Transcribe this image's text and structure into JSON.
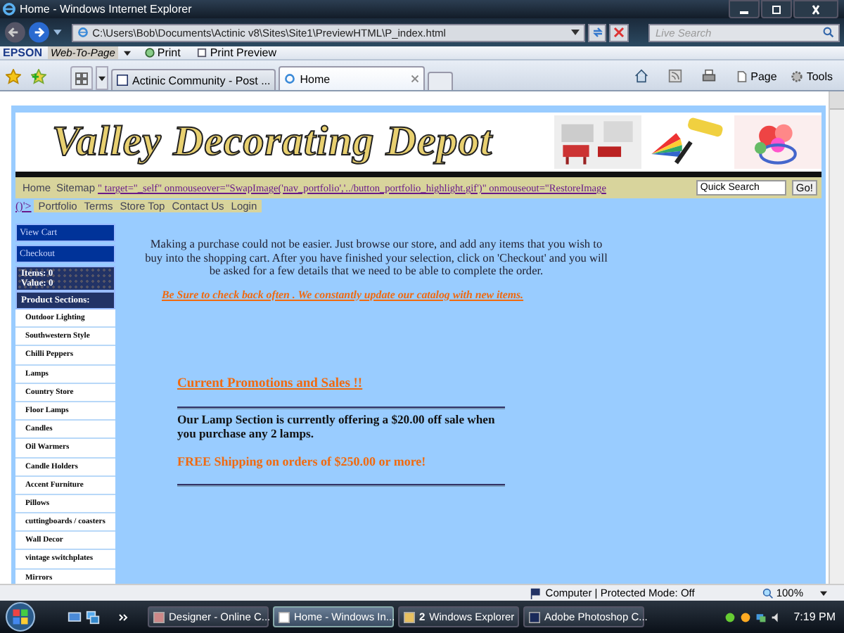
{
  "window": {
    "title": "Home - Windows Internet Explorer"
  },
  "address_bar": {
    "value": "C:\\Users\\Bob\\Documents\\Actinic v8\\Sites\\Site1\\PreviewHTML\\P_index.html",
    "search_placeholder": "Live Search"
  },
  "epson_toolbar": {
    "brand": "EPSON",
    "web_to_page": "Web-To-Page",
    "print": "Print",
    "print_preview": "Print Preview"
  },
  "tabs": [
    {
      "label": "Actinic Community - Post ...",
      "selected": false
    },
    {
      "label": "Home",
      "selected": true
    }
  ],
  "command_bar": {
    "page": "Page",
    "tools": "Tools"
  },
  "site": {
    "title": "Valley Decorating Depot",
    "nav_row_1": [
      "Home",
      "Sitemap"
    ],
    "stray_link_1": "\" target=\"_self\" onmouseover=\"SwapImage('nav_portfolio','../button_portfolio_highlight.gif')\" onmouseout=\"RestoreImage",
    "stray_link_2": "()'>",
    "nav_row_2": [
      "Portfolio",
      "Terms",
      "Store Top",
      "Contact Us",
      "Login"
    ],
    "quick_search_value": "Quick Search",
    "go_button": "Go!"
  },
  "sidebar": {
    "view_cart": "View Cart",
    "checkout": "Checkout",
    "items": "Items: 0",
    "value": "Value: 0",
    "sections_heading": "Product Sections:",
    "products": [
      "Outdoor Lighting",
      "Southwestern Style",
      "Chilli Peppers",
      "Lamps",
      "Country Store",
      "Floor Lamps",
      "Candles",
      "Oil Warmers",
      "Candle Holders",
      "Accent Furniture",
      "Pillows",
      "cuttingboards / coasters",
      "Wall Decor",
      "vintage switchplates",
      "Mirrors"
    ]
  },
  "content": {
    "intro": "Making a purchase could not be easier. Just browse our store, and add any items that you wish to buy into the shopping cart. After you have finished your selection, click on 'Checkout' and you will be asked for a few details that we need to be able to complete the order.",
    "check_back": "Be Sure to check back often .  We constantly update our catalog with new items.",
    "promotions_heading": "Current Promotions and Sales !!",
    "lamp_offer": "Our Lamp Section is currently offering a $20.00 off sale when you purchase any 2 lamps.",
    "free_shipping": "FREE Shipping on orders of $250.00 or more!"
  },
  "status_bar": {
    "zone": "Computer | Protected Mode: Off",
    "zoom": "100%"
  },
  "taskbar": {
    "items": [
      {
        "label": "Designer - Online C...",
        "selected": false
      },
      {
        "label": "Home - Windows In...",
        "selected": true
      },
      {
        "count": "2",
        "label": "Windows Explorer",
        "selected": false
      },
      {
        "label": "Adobe Photoshop C...",
        "selected": false
      }
    ],
    "time": "7:19 PM"
  }
}
